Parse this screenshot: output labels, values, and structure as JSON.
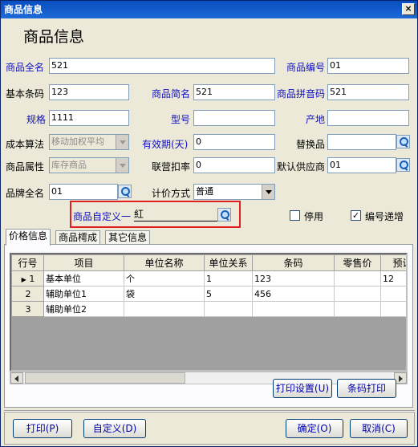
{
  "window": {
    "title": "商品信息",
    "close_glyph": "×"
  },
  "page_title": "商品信息",
  "fields": {
    "full_name": {
      "label": "商品全名",
      "value": "521"
    },
    "code": {
      "label": "商品编号",
      "value": "01"
    },
    "barcode": {
      "label": "基本条码",
      "value": "123"
    },
    "short_name": {
      "label": "商品简名",
      "value": "521"
    },
    "pinyin": {
      "label": "商品拼音码",
      "value": "521"
    },
    "spec": {
      "label": "规格",
      "value": "1111"
    },
    "model": {
      "label": "型号",
      "value": ""
    },
    "origin": {
      "label": "产地",
      "value": ""
    },
    "cost_method": {
      "label": "成本算法",
      "value": "移动加权平均"
    },
    "validity": {
      "label": "有效期(天)",
      "value": "0"
    },
    "substitute": {
      "label": "替换品",
      "value": ""
    },
    "attribute": {
      "label": "商品属性",
      "value": "库存商品"
    },
    "discount": {
      "label": "联营扣率",
      "value": "0"
    },
    "supplier": {
      "label": "默认供应商",
      "value": "01"
    },
    "brand": {
      "label": "品牌全名",
      "value": "01"
    },
    "pricing": {
      "label": "计价方式",
      "value": "普通"
    },
    "custom1": {
      "label": "商品自定义一",
      "value": "紅"
    }
  },
  "checkboxes": {
    "disable": {
      "label": "停用",
      "checked": false
    },
    "auto_increment": {
      "label": "编号递增",
      "checked": true
    }
  },
  "tabs": [
    {
      "label": "价格信息",
      "active": true
    },
    {
      "label": "商品樗成",
      "active": false
    },
    {
      "label": "其它信息",
      "active": false
    }
  ],
  "table": {
    "columns": [
      "行号",
      "项目",
      "单位名称",
      "单位关系",
      "条码",
      "零售价",
      "预设"
    ],
    "rows": [
      {
        "num": "1",
        "item": "基本单位",
        "unit": "个",
        "relation": "1",
        "barcode": "123",
        "retail": "",
        "preset": "12"
      },
      {
        "num": "2",
        "item": "辅助单位1",
        "unit": "袋",
        "relation": "5",
        "barcode": "456",
        "retail": "",
        "preset": ""
      },
      {
        "num": "3",
        "item": "辅助单位2",
        "unit": "",
        "relation": "",
        "barcode": "",
        "retail": "",
        "preset": ""
      }
    ]
  },
  "buttons": {
    "print_settings": "打印设置(U)",
    "barcode_print": "条码打印",
    "print": "打印(P)",
    "custom": "自定义(D)",
    "ok": "确定(O)",
    "cancel": "取消(C)"
  },
  "colors": {
    "title_bar": "#0a4ec0",
    "required_label": "#1010c0",
    "highlight_box": "#e02020"
  }
}
